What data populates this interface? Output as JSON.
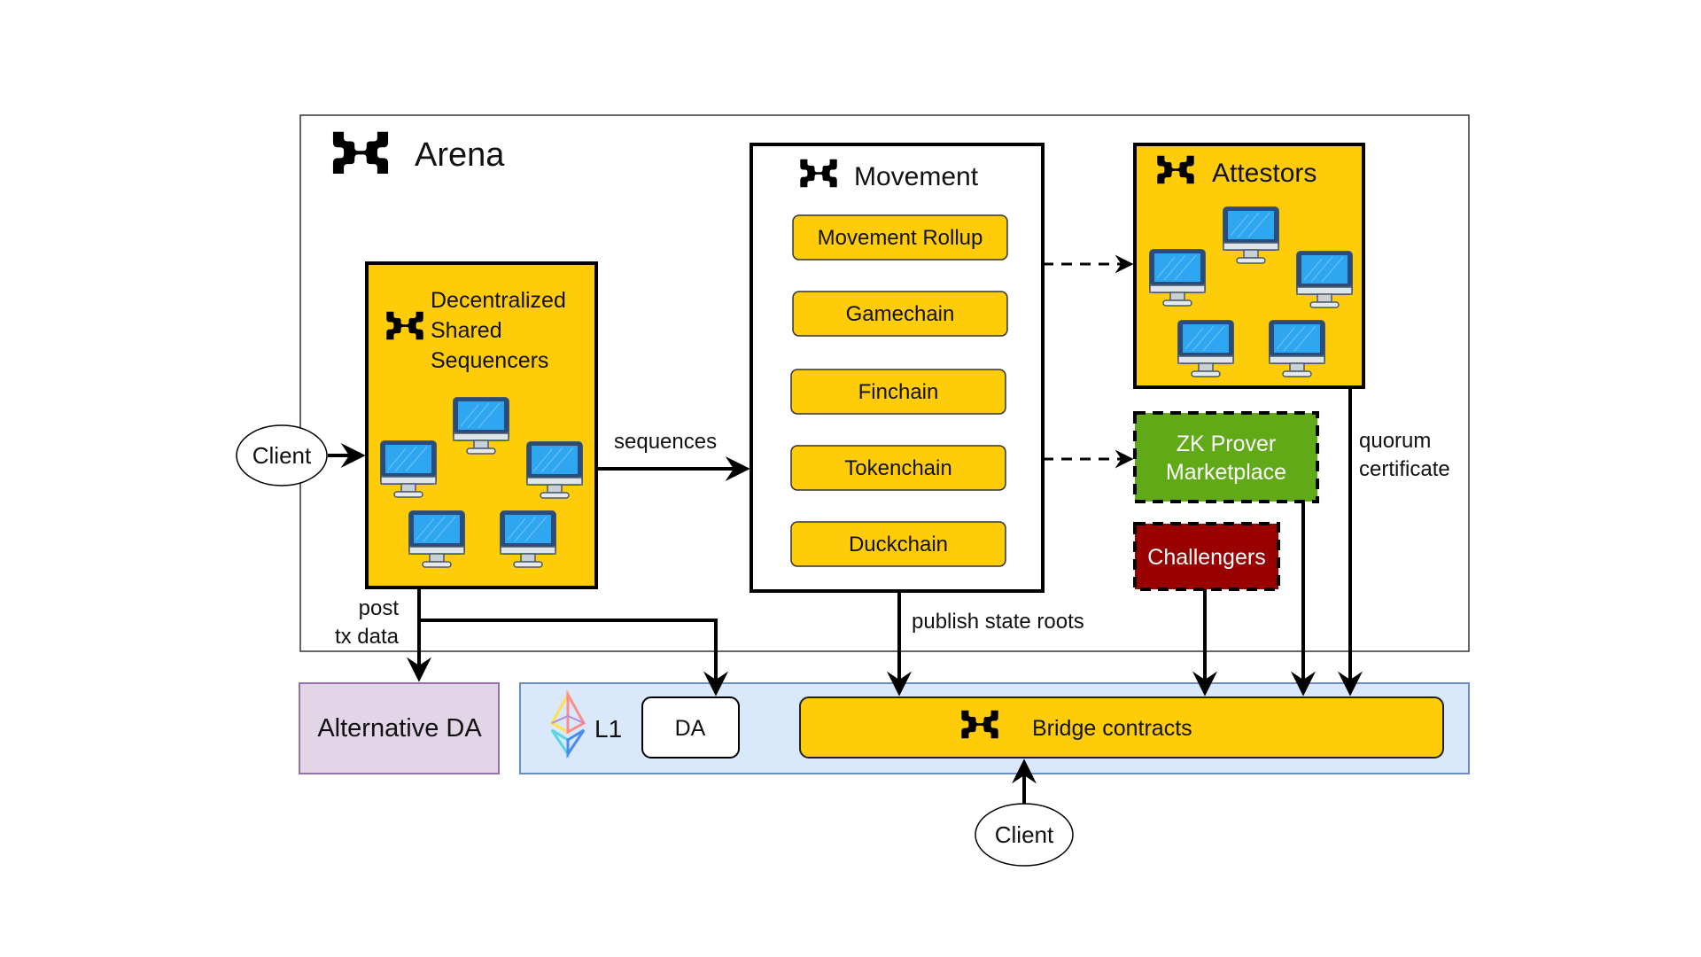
{
  "arena": {
    "title": "Arena"
  },
  "sequencers": {
    "title_lines": [
      "Decentralized",
      "Shared",
      "Sequencers"
    ]
  },
  "movement": {
    "title": "Movement",
    "chains": [
      "Movement Rollup",
      "Gamechain",
      "Finchain",
      "Tokenchain",
      "Duckchain"
    ]
  },
  "attestors": {
    "title": "Attestors"
  },
  "zk_prover": {
    "title_lines": [
      "ZK Prover",
      "Marketplace"
    ]
  },
  "challengers": {
    "title": "Challengers"
  },
  "alt_da": {
    "title": "Alternative DA"
  },
  "l1": {
    "title": "L1",
    "da_label": "DA",
    "bridge_label": "Bridge contracts"
  },
  "clients": {
    "left": "Client",
    "bottom": "Client"
  },
  "edge_labels": {
    "sequences": "sequences",
    "post_tx_data": [
      "post",
      "tx data"
    ],
    "publish_state_roots": "publish state roots",
    "quorum_certificate": [
      "quorum",
      "certificate"
    ]
  },
  "colors": {
    "yellow": "#FFCC09",
    "green": "#60A917",
    "red": "#990000",
    "alt_da_fill": "#E1D5E7",
    "alt_da_stroke": "#9673A6",
    "l1_fill": "#DAE8FC",
    "l1_stroke": "#6C8EBF",
    "screen_blue": "#2FA6F0"
  }
}
